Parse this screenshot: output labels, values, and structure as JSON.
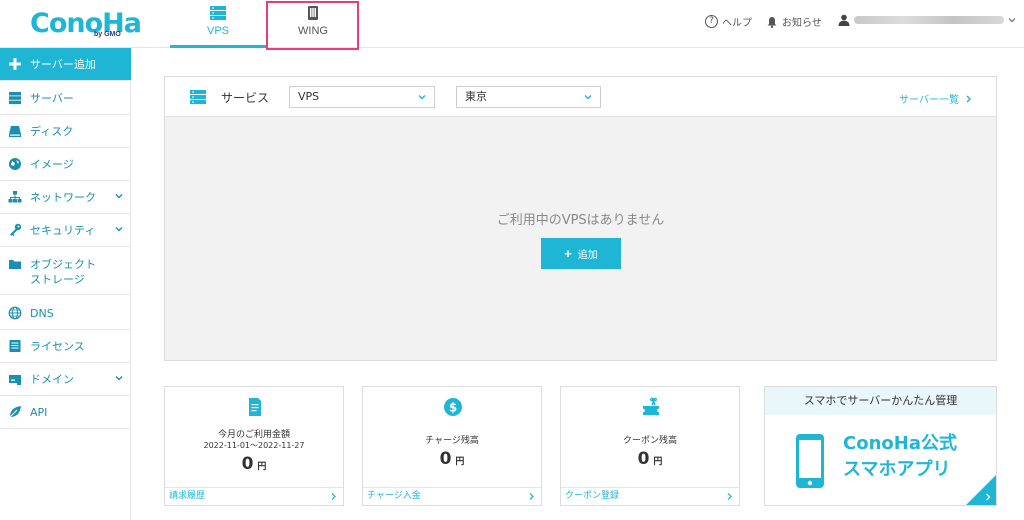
{
  "header": {
    "logo_text": "ConoHa",
    "logo_sub": "by GMO",
    "tabs": [
      {
        "label": "VPS",
        "icon": "server-icon",
        "active": true
      },
      {
        "label": "WING",
        "icon": "wing-icon",
        "active": false
      }
    ],
    "help_label": "ヘルプ",
    "notice_label": "お知らせ",
    "user_icon": "user-icon"
  },
  "sidebar": {
    "items": [
      {
        "label": "サーバー追加",
        "icon": "plus-icon",
        "active": true
      },
      {
        "label": "サーバー",
        "icon": "server-icon"
      },
      {
        "label": "ディスク",
        "icon": "disk-icon"
      },
      {
        "label": "イメージ",
        "icon": "image-icon"
      },
      {
        "label": "ネットワーク",
        "icon": "network-icon",
        "expandable": true
      },
      {
        "label": "セキュリティ",
        "icon": "key-icon",
        "expandable": true
      },
      {
        "label_line1": "オブジェクト",
        "label_line2": "ストレージ",
        "icon": "folder-icon"
      },
      {
        "label": "DNS",
        "icon": "globe-icon"
      },
      {
        "label": "ライセンス",
        "icon": "license-icon"
      },
      {
        "label": "ドメイン",
        "icon": "domain-icon",
        "expandable": true
      },
      {
        "label": "API",
        "icon": "leaf-icon"
      }
    ]
  },
  "service_panel": {
    "label": "サービス",
    "service_select": "VPS",
    "region_select": "東京",
    "server_list_link": "サーバー一覧",
    "empty_message": "ご利用中のVPSはありません",
    "add_button": "追加"
  },
  "cards": {
    "usage": {
      "title": "今月のご利用金額",
      "period": "2022-11-01～2022-11-27",
      "amount": "0",
      "unit": "円",
      "footer": "請求履歴"
    },
    "charge": {
      "title": "チャージ残高",
      "amount": "0",
      "unit": "円",
      "footer": "チャージ入金"
    },
    "coupon": {
      "title": "クーポン残高",
      "amount": "0",
      "unit": "円",
      "footer": "クーポン登録"
    },
    "app": {
      "top_text": "スマホでサーバーかんたん管理",
      "name_line1": "ConoHa公式",
      "name_line2": "スマホアプリ"
    }
  },
  "colors": {
    "accent": "#1fb6d6",
    "highlight": "#e83c7e",
    "panel_bg": "#f2f2f2"
  }
}
